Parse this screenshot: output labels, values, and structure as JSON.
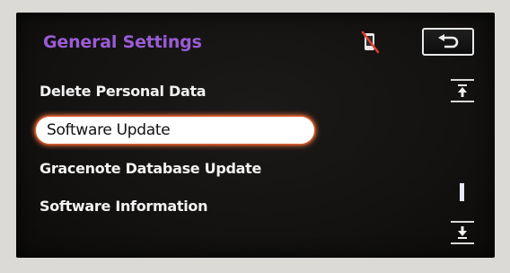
{
  "header": {
    "title": "General Settings",
    "status_icon": "phone-disconnected-icon",
    "back_icon": "back-arrow-icon"
  },
  "menu": {
    "items": [
      {
        "label": "Delete Personal Data",
        "selected": false
      },
      {
        "label": "Software Update",
        "selected": true
      },
      {
        "label": "Gracenote Database Update",
        "selected": false
      },
      {
        "label": "Software Information",
        "selected": false
      }
    ]
  },
  "scrollbar": {
    "up_icon": "page-up-icon",
    "down_icon": "page-down-icon"
  },
  "colors": {
    "title": "#9b5cd6",
    "highlight": "#ffffff",
    "highlight_glow": "#ff7a3c",
    "screen_bg": "#131211"
  }
}
